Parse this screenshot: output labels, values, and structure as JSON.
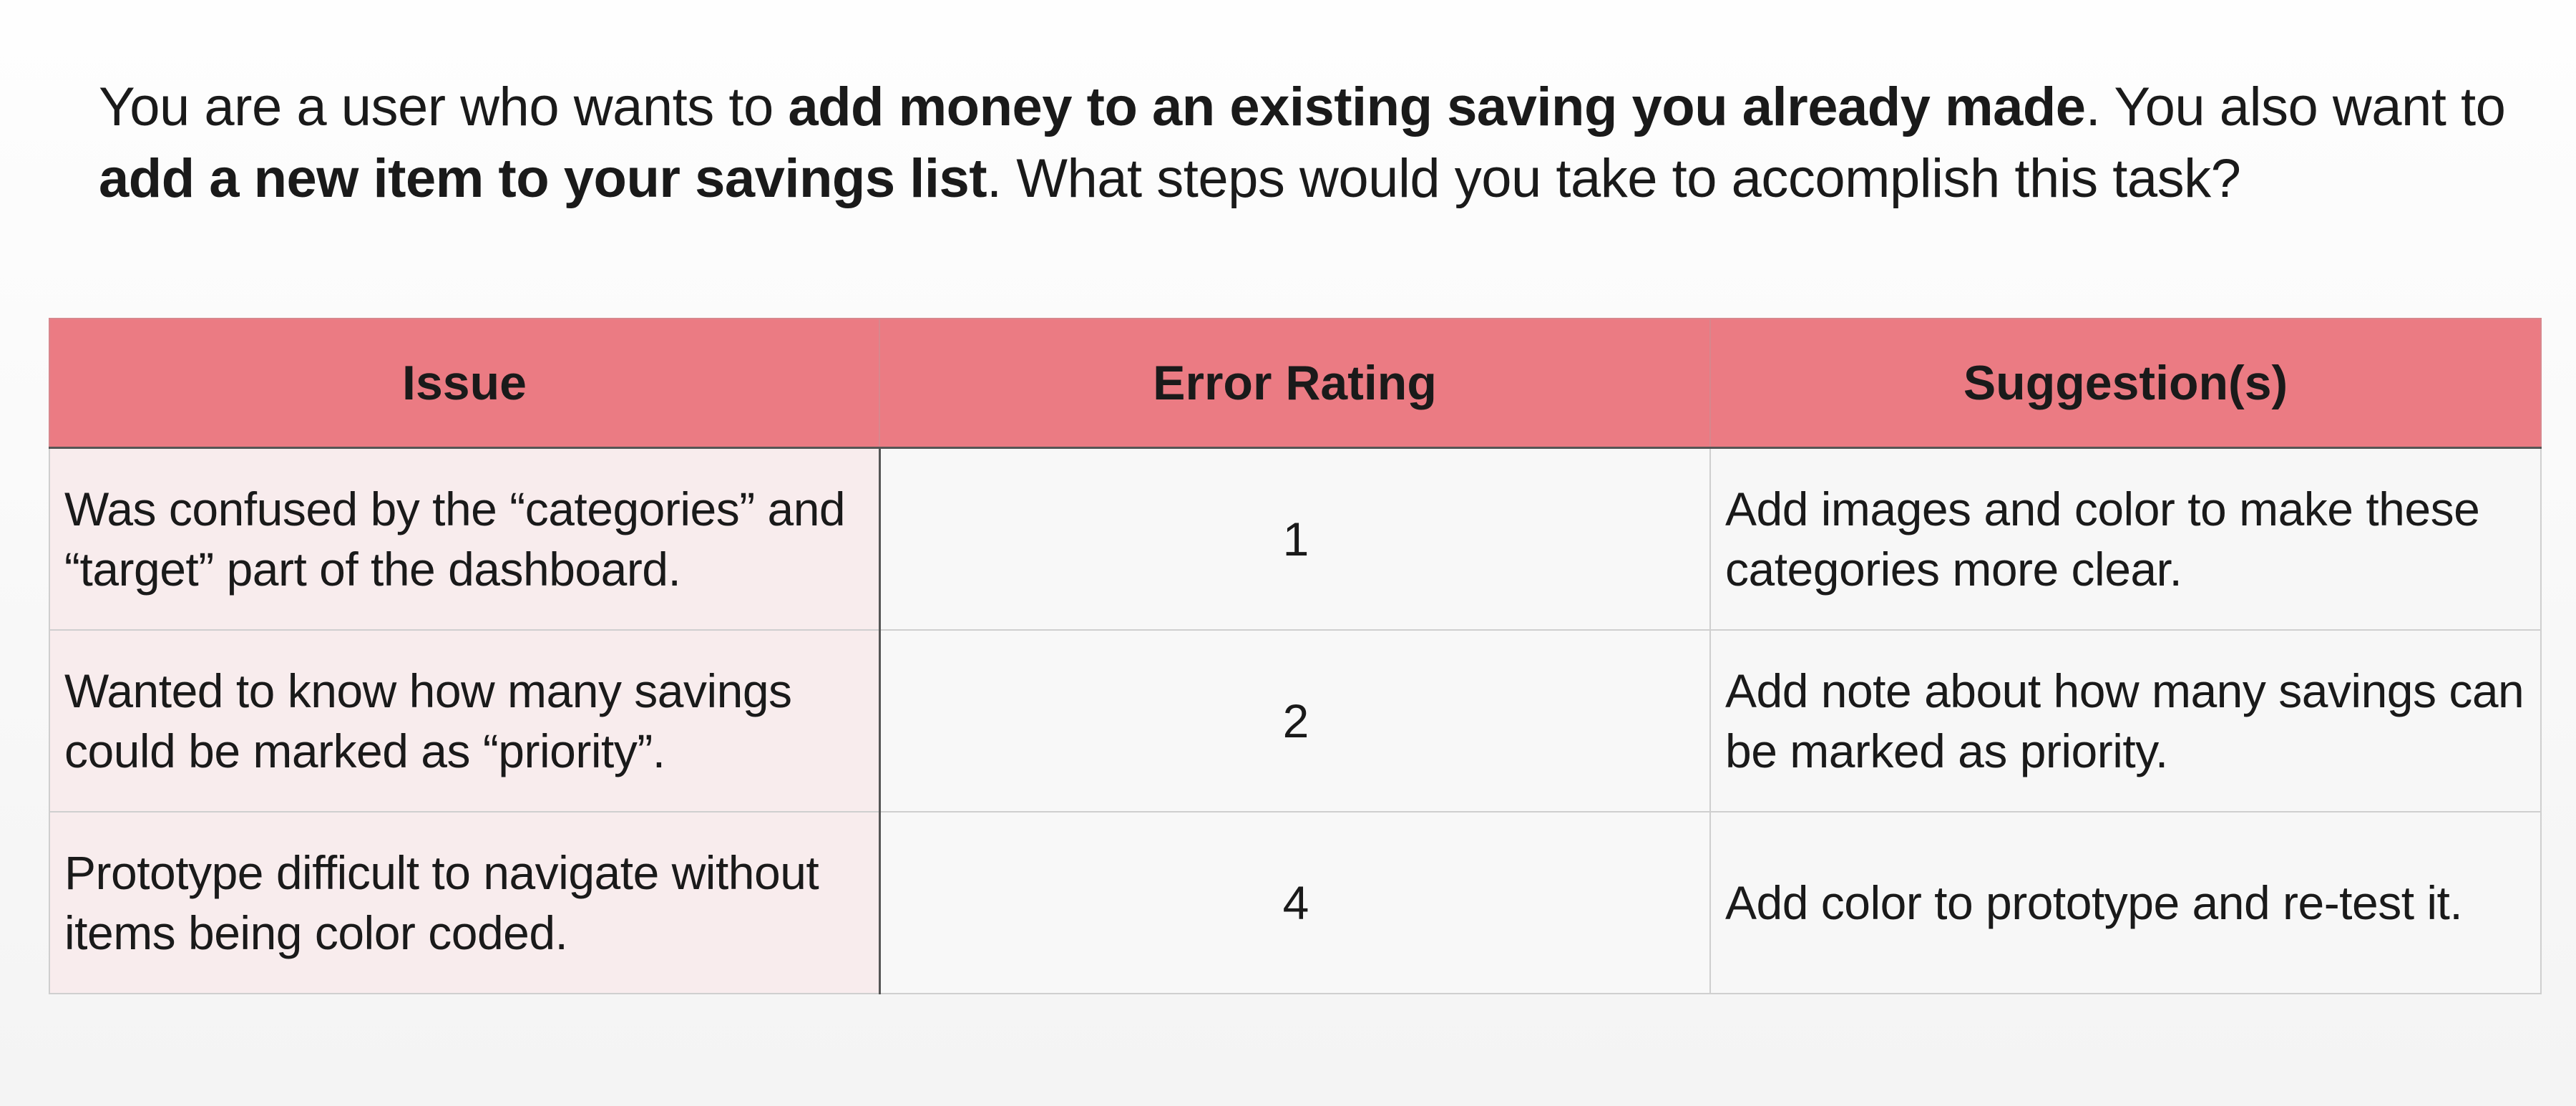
{
  "prompt": {
    "part1": "You are a user who wants to ",
    "bold1": "add money to an existing saving you already made",
    "part2": ". You also want to ",
    "bold2": "add a new item to your savings list",
    "part3": ". What steps would you take to accomplish this task?"
  },
  "table": {
    "headers": {
      "issue": "Issue",
      "rating": "Error Rating",
      "suggestion": "Suggestion(s)"
    },
    "rows": [
      {
        "issue": "Was confused by the “categories” and “target” part of the dashboard.",
        "rating": "1",
        "suggestion": "Add images and color to make these categories more clear."
      },
      {
        "issue": "Wanted to know how many savings could be marked as “priority”.",
        "rating": "2",
        "suggestion": "Add note about how many savings can be marked as priority."
      },
      {
        "issue": "Prototype difficult to navigate without items being color coded.",
        "rating": "4",
        "suggestion": "Add color to prototype and re-test it."
      }
    ]
  },
  "colors": {
    "header_bg": "#eb7b83",
    "issue_col_bg": "#f8eced",
    "cell_bg": "#f8f8f8"
  }
}
